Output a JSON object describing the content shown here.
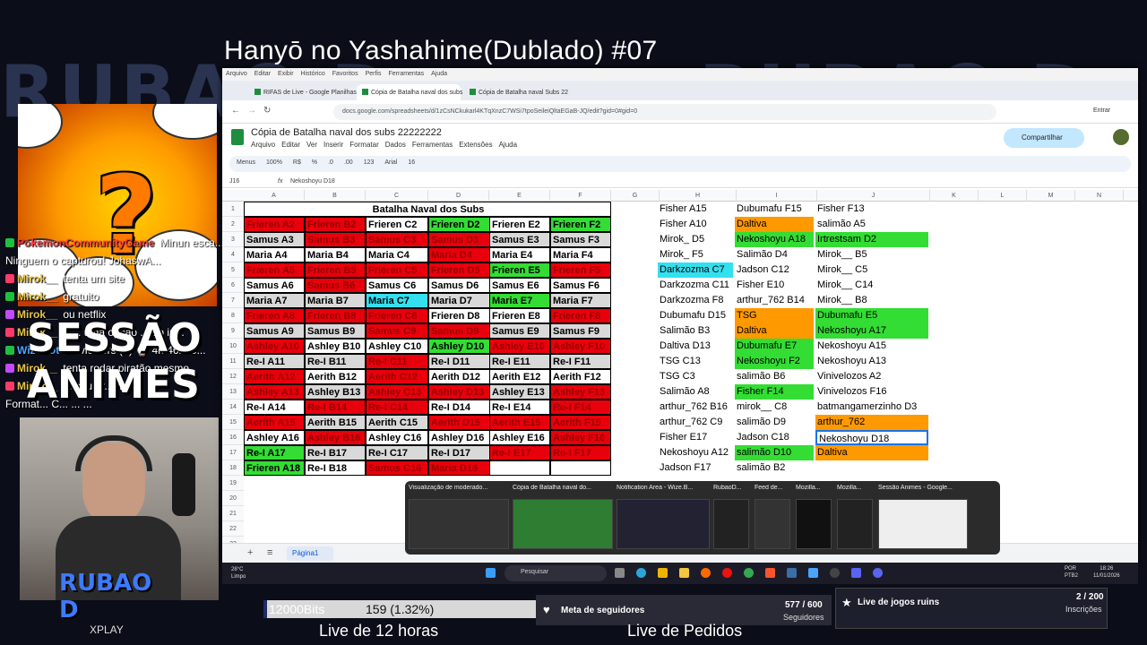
{
  "stream": {
    "title": "Hanyō no Yashahime(Dublado) #07",
    "sessao_line1": "SESSÃO",
    "sessao_line2": "ANIMES",
    "brand": "RUBAO D",
    "brand_sub": "XPLAY",
    "subathon_left": "Live  de 12 horas",
    "subathon_right": "Live de Pedidos"
  },
  "chat": [
    {
      "user": "PokemonCommunityGame",
      "text": "Minun esca...",
      "color": "#ff3b3b"
    },
    {
      "user": "",
      "text": "Ninguem o capturou! JohaswA...",
      "color": "#ffffff"
    },
    {
      "user": "Mirok__",
      "text": "tenta um site",
      "color": "#e6c34a"
    },
    {
      "user": "Mirok__",
      "text": "gratuito",
      "color": "#e6c34a"
    },
    {
      "user": "Mirok__",
      "text": "ou netflix",
      "color": "#e6c34a"
    },
    {
      "user": "Mirok__",
      "text": "e ... uma opção ... ão in...",
      "color": "#e6c34a"
    },
    {
      "user": "WizeBot",
      "text": "15 viewers (=) ⌚ 4h 46m 5...",
      "color": "#4aa3ff"
    },
    {
      "user": "Mirok__",
      "text": "tenta rodar piratão mesmo",
      "color": "#e6c34a"
    },
    {
      "user": "Mirok__",
      "text": "... seu pr... ma",
      "color": "#e6c34a"
    },
    {
      "user": "",
      "text": "Format... C... ... ...",
      "color": "#ffffff"
    }
  ],
  "browser": {
    "menu": [
      "Arquivo",
      "Editar",
      "Exibir",
      "Histórico",
      "Favoritos",
      "Perfis",
      "Ferramentas",
      "Ajuda"
    ],
    "tabs": [
      "RIFAS de Live - Google Planilhas",
      "Cópia de Batalha naval dos subs",
      "Cópia de Batalha naval Subs 22"
    ],
    "url": "docs.google.com/spreadsheets/d/1zCsNCkukarl4KTqXnzC7WSi7tpoSeileiQltaEGaB-JQ/edit?gid=0#gid=0",
    "profile": "Entrar"
  },
  "sheet": {
    "doc_title": "Cópia de Batalha naval dos subs 22222222",
    "menu": [
      "Arquivo",
      "Editar",
      "Ver",
      "Inserir",
      "Formatar",
      "Dados",
      "Ferramentas",
      "Extensões",
      "Ajuda"
    ],
    "share": "Compartilhar",
    "toolbar": [
      "Menus",
      "100%",
      "R$",
      "%",
      ".0",
      ".00",
      "123",
      "Arial",
      "16"
    ],
    "cell_ref": "J16",
    "formula": "Nekoshoyu D18",
    "columns": [
      "A",
      "B",
      "C",
      "D",
      "E",
      "F",
      "G",
      "H",
      "I",
      "J",
      "K",
      "L",
      "M",
      "N"
    ],
    "rows": [
      "1",
      "2",
      "3",
      "4",
      "5",
      "6",
      "7",
      "8",
      "9",
      "10",
      "11",
      "12",
      "13",
      "14",
      "15",
      "16",
      "17",
      "18",
      "19",
      "20",
      "21",
      "22",
      "23",
      "24"
    ],
    "board_title": "Batalha Naval dos Subs",
    "board": [
      [
        "Frieren A2|red",
        "Frieren B2|red",
        "Frieren C2|wht",
        "Frieren D2|grn",
        "Frieren E2|wht",
        "Frieren F2|grn"
      ],
      [
        "Samus A3|gry",
        "Samus B3|red",
        "Samus C3|red",
        "Samus D3|red",
        "Samus E3|gry",
        "Samus F3|gry"
      ],
      [
        "Maria A4|wht",
        "Maria B4|wht",
        "Maria C4|wht",
        "Maria D4|red",
        "Maria E4|wht",
        "Maria F4|wht"
      ],
      [
        "Frieren A5|red",
        "Frieren B5|red",
        "Frieren C5|red",
        "Frieren D5|red",
        "Frieren E5|grn",
        "Frieren F5|red"
      ],
      [
        "Samus A6|wht",
        "Samus B6|red",
        "Samus C6|wht",
        "Samus D6|wht",
        "Samus E6|wht",
        "Samus F6|wht"
      ],
      [
        "Maria A7|gry",
        "Maria B7|gry",
        "Maria C7|cyn",
        "Maria D7|gry",
        "Maria E7|grn",
        "Maria F7|gry"
      ],
      [
        "Frieren A8|red",
        "Frieren B8|red",
        "Frieren C8|red",
        "Frieren D8|wht",
        "Frieren E8|wht",
        "Frieren F8|red"
      ],
      [
        "Samus A9|gry",
        "Samus B9|gry",
        "Samus C9|red",
        "Samus D9|red",
        "Samus E9|gry",
        "Samus F9|gry"
      ],
      [
        "Ashley A10|red",
        "Ashley B10|wht",
        "Ashley C10|wht",
        "Ashley D10|grn",
        "Ashley E10|red",
        "Ashley F10|red"
      ],
      [
        "Re-I A11|gry",
        "Re-I B11|gry",
        "Re-I C11|red",
        "Re-I D11|gry",
        "Re-I E11|gry",
        "Re-I F11|gry"
      ],
      [
        "Aerith A12|red",
        "Aerith B12|wht",
        "Aerith C12|red",
        "Aerith D12|wht",
        "Aerith E12|wht",
        "Aerith F12|wht"
      ],
      [
        "Ashley A13|red",
        "Ashley B13|gry",
        "Ashley C13|red",
        "Ashley D13|red",
        "Ashley E13|gry",
        "Ashley F13|red"
      ],
      [
        "Re-I A14|wht",
        "Re-I B14|red",
        "Re-I C14|red",
        "Re-I D14|wht",
        "Re-I E14|wht",
        "Re-I F14|red"
      ],
      [
        "Aerith A15|red",
        "Aerith B15|gry",
        "Aerith C15|gry",
        "Aerith D15|red",
        "Aerith E15|red",
        "Aerith F15|red"
      ],
      [
        "Ashley A16|wht",
        "Ashley B16|red",
        "Ashley C16|wht",
        "Ashley D16|wht",
        "Ashley E16|wht",
        "Ashley F16|red"
      ],
      [
        "Re-I A17|grn",
        "Re-I B17|gry",
        "Re-I C17|gry",
        "Re-I D17|gry",
        "Re-I E17|red",
        "Re-I F17|red"
      ],
      [
        "Frieren A18|grn",
        "Re-I B18|wht",
        "Samus C18|red",
        "Maria D18|red",
        "|wht",
        "|wht"
      ]
    ],
    "side": [
      [
        "Fisher A15|",
        "Dubumafu F15|",
        "Fisher F13|"
      ],
      [
        "Fisher A10|",
        "Daltiva|org",
        "salimão A5|"
      ],
      [
        "Mirok_ D5|",
        "Nekoshoyu A18|grn",
        "Irtrestsam D2|grn"
      ],
      [
        "Mirok_ F5|",
        "Salimão D4|",
        "Mirok__ B5|"
      ],
      [
        "Darkzozma C7|cyn",
        "Jadson C12|",
        "Mirok__ C5|"
      ],
      [
        "Darkzozma C11|",
        "Fisher E10|",
        "Mirok__ C14|"
      ],
      [
        "Darkzozma F8|",
        "arthur_762 B14|",
        "Mirok__ B8|"
      ],
      [
        "Dubumafu D15|",
        "TSG|org",
        "Dubumafu E5|grn"
      ],
      [
        "Salimão B3|",
        "Daltiva|org",
        "Nekoshoyu A17|grn"
      ],
      [
        "Daltiva D13|",
        "Dubumafu E7|grn",
        "Nekoshoyu A15|"
      ],
      [
        "TSG C13|",
        "Nekoshoyu F2|grn",
        "Nekoshoyu A13|"
      ],
      [
        "TSG C3|",
        "salimão B6|",
        "Vinivelozos A2|"
      ],
      [
        "Salimão A8|",
        "Fisher F14|grn",
        "Vinivelozos F16|"
      ],
      [
        "arthur_762 B16|",
        "mirok__ C8|",
        "batmangamerzinho D3|"
      ],
      [
        "arthur_762 C9|",
        "salimão D9|",
        "arthur_762|org"
      ],
      [
        "Fisher E17|",
        "Jadson C18|",
        "Nekoshoyu D18|sel"
      ],
      [
        "Nekoshoyu A12|",
        "salimão D10|grn",
        "Daltiva|org"
      ],
      [
        "Jadson F17|",
        "salimão B2|",
        "|"
      ]
    ],
    "page_tab": "Página1"
  },
  "thumbs": [
    "Visualização de moderado...",
    "Cópia de Batalha naval do...",
    "Notification Area - Wize.B...",
    "RubaoD...",
    "Feed de...",
    "Mozilla...",
    "Mozilla...",
    "Sessão Animes - Google..."
  ],
  "taskbar": {
    "weather_temp": "28°C",
    "weather_desc": "Limpo",
    "search": "Pesquisar",
    "lang": "POR",
    "lang2": "PTB2",
    "time": "18:26",
    "date": "11/01/2026"
  },
  "overlay": {
    "bits_label": "12000Bits",
    "bits_value": "159 (1.32%)",
    "bits_progress": 0.0132,
    "meta_label": "Meta de seguidores",
    "meta_count": "577 / 600",
    "meta_sub": "Seguidores",
    "live_label": "Live de jogos ruins",
    "live_count": "2 / 200",
    "live_sub": "Inscrições"
  }
}
